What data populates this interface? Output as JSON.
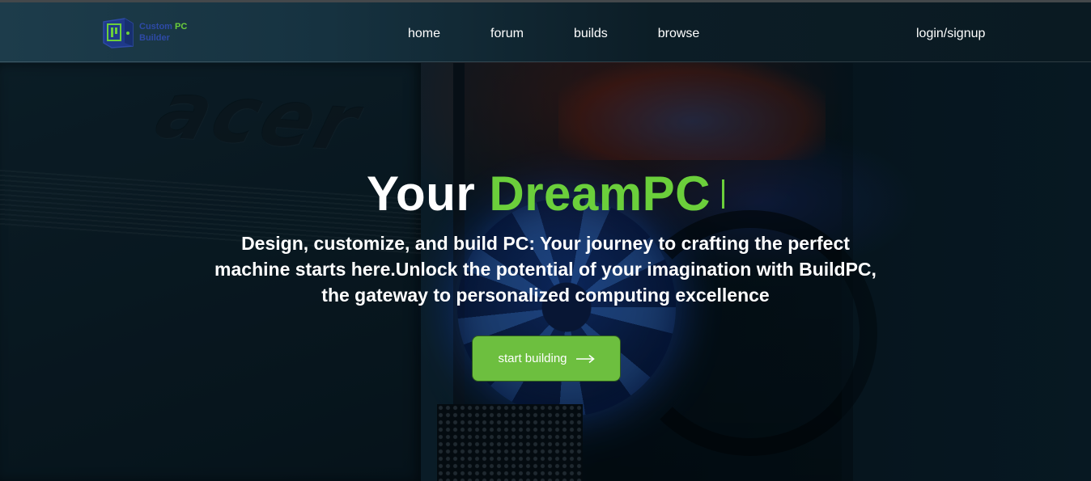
{
  "brand": {
    "line1": "Custom",
    "line1_accent": "PC",
    "line2": "Builder"
  },
  "nav": {
    "items": [
      {
        "label": "home"
      },
      {
        "label": "forum"
      },
      {
        "label": "builds"
      },
      {
        "label": "browse"
      }
    ],
    "login_label": "login/signup"
  },
  "hero": {
    "headline_prefix": "Your",
    "headline_accent": "DreamPC",
    "subtitle": "Design, customize, and build PC: Your journey to crafting the perfect machine starts here.Unlock the potential of your imagination with BuildPC, the gateway to personalized computing excellence",
    "cta_label": "start building"
  },
  "background": {
    "monitor_brand": "acer"
  },
  "colors": {
    "accent_green": "#6bcf3b",
    "cta_green": "#6dbf3f",
    "logo_blue": "#2e4aa6",
    "nav_bg": "#163240"
  },
  "icons": {
    "logo": "pc-case-logo-icon",
    "cta_arrow": "arrow-right-icon"
  }
}
